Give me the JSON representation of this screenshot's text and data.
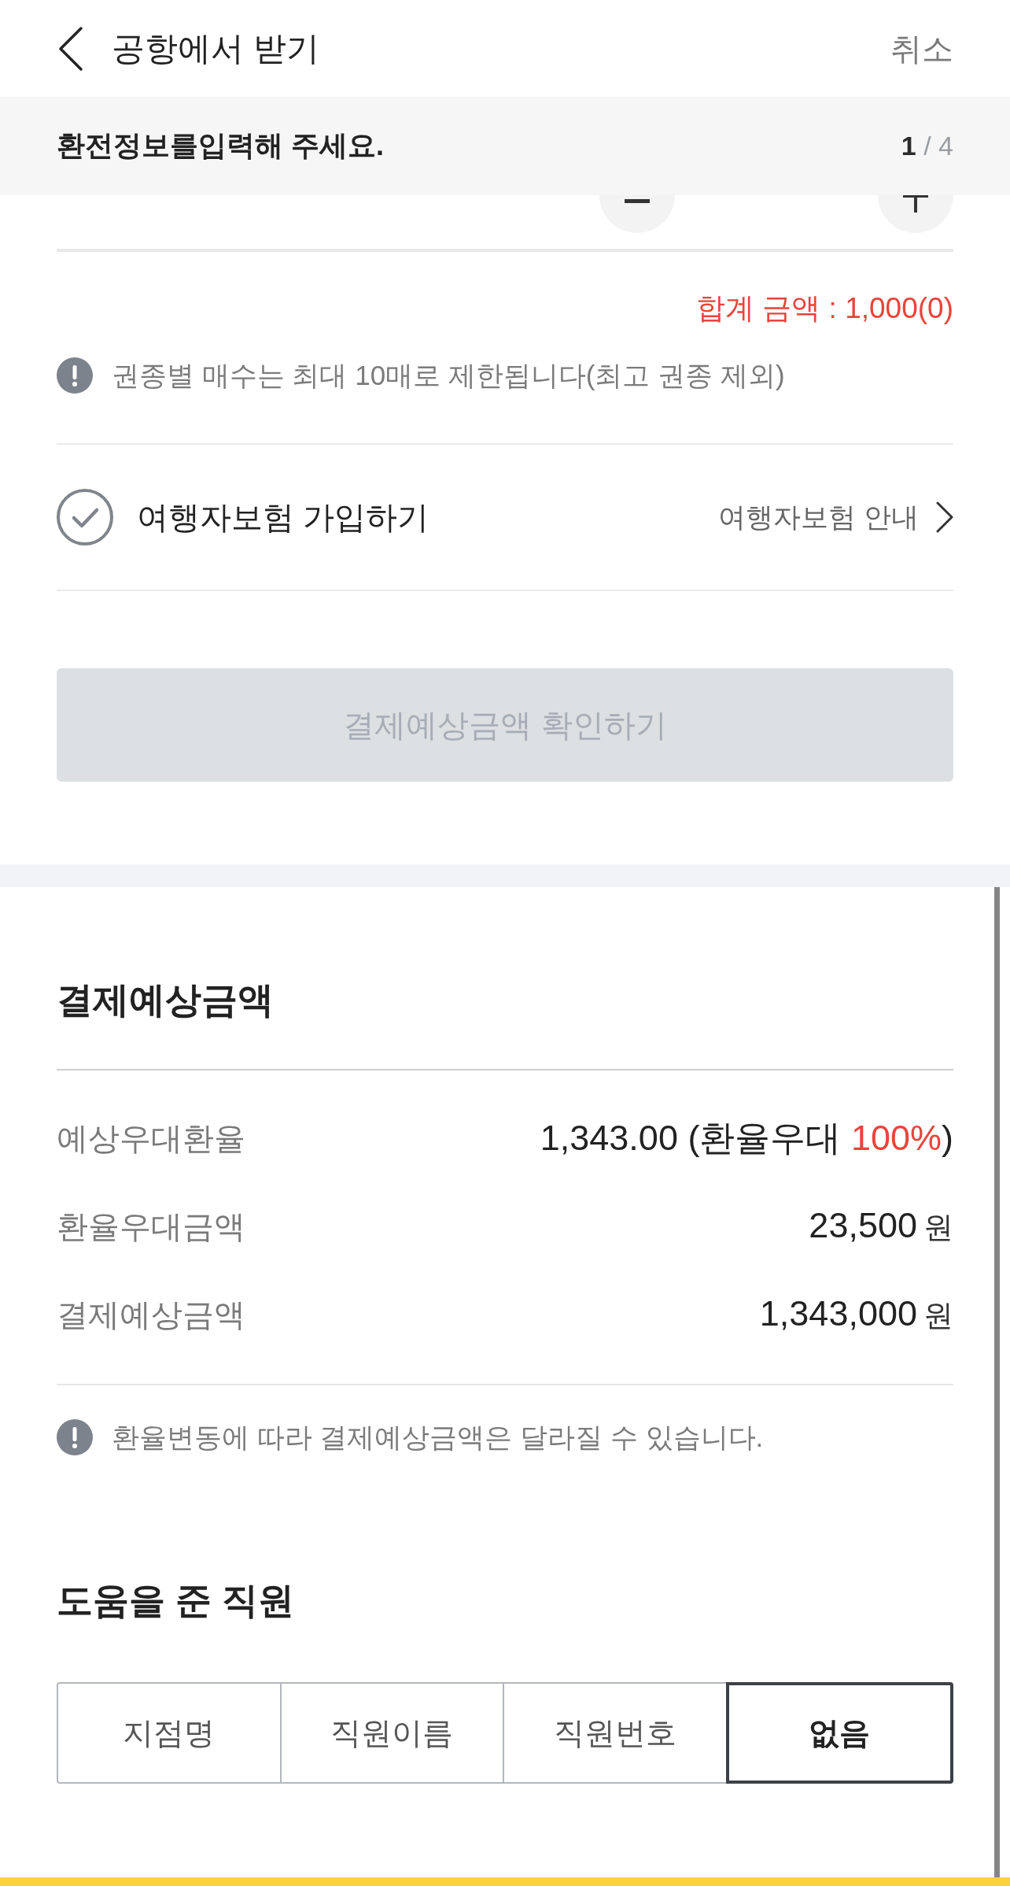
{
  "header": {
    "title": "공항에서 받기",
    "action": "취소"
  },
  "step_banner": {
    "message": "환전정보를입력해 주세요.",
    "current": "1",
    "of_total": "/ 4"
  },
  "total": "합계 금액 : 1,000(0)",
  "limit_notice": "권종별 매수는 최대 10매로 제한됩니다(최고 권종 제외)",
  "insurance": {
    "label": "여행자보험 가입하기",
    "checked": false,
    "link": "여행자보험 안내"
  },
  "confirm_button": {
    "label": "결제예상금액 확인하기",
    "disabled": true
  },
  "estimate": {
    "title": "결제예상금액",
    "rows": [
      {
        "kind": "rate",
        "label": "예상우대환율",
        "parts": [
          {
            "text": "1,343.00 (환율우대 ",
            "highlight": false
          },
          {
            "text": "100%",
            "highlight": true
          },
          {
            "text": ")",
            "highlight": false
          }
        ]
      },
      {
        "kind": "amount",
        "label": "환율우대금액",
        "value": "23,500",
        "unit": "원"
      },
      {
        "kind": "amount",
        "label": "결제예상금액",
        "value": "1,343,000",
        "unit": "원"
      }
    ],
    "notice": "환율변동에 따라 결제예상금액은 달라질 수 있습니다."
  },
  "staff": {
    "title": "도움을 준 직원",
    "options": [
      {
        "label": "지점명",
        "selected": false
      },
      {
        "label": "직원이름",
        "selected": false
      },
      {
        "label": "직원번호",
        "selected": false
      },
      {
        "label": "없음",
        "selected": true
      }
    ]
  }
}
